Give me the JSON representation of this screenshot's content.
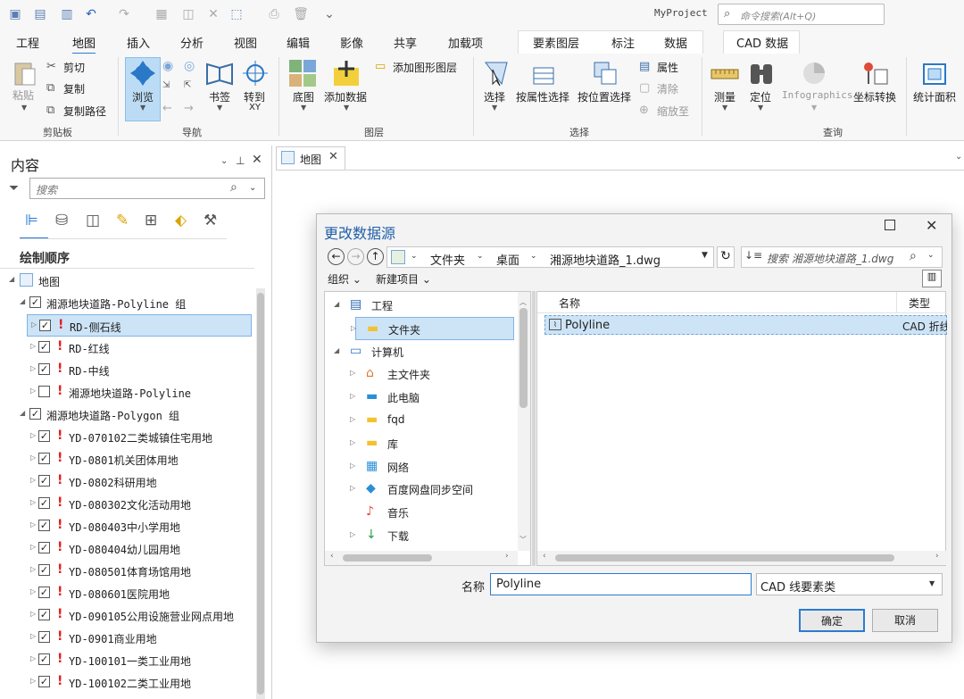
{
  "app": {
    "project_title": "MyProject",
    "command_search_placeholder": "命令搜索(Alt+Q)"
  },
  "ribbon": {
    "tabs": [
      "工程",
      "地图",
      "插入",
      "分析",
      "视图",
      "编辑",
      "影像",
      "共享",
      "加载项"
    ],
    "context_tabs": [
      "要素图层",
      "标注",
      "数据"
    ],
    "cad_tab": "CAD 数据",
    "active_tab": "地图",
    "clipboard": {
      "paste": "粘贴",
      "cut": "剪切",
      "copy": "复制",
      "copy_path": "复制路径",
      "label": "剪贴板"
    },
    "navigate": {
      "explore": "浏览",
      "bookmarks": "书签",
      "goto": "转到",
      "goto_sub": "XY",
      "label": "导航"
    },
    "layer": {
      "basemap": "底图",
      "add_data": "添加数据",
      "add_graphics": "添加图形图层",
      "label": "图层"
    },
    "selection": {
      "select": "选择",
      "by_attr": "按属性选择",
      "by_loc": "按位置选择",
      "attributes": "属性",
      "clear": "清除",
      "zoom_to": "缩放至",
      "label": "选择"
    },
    "inquiry": {
      "measure": "测量",
      "locate": "定位",
      "infographics": "Infographics",
      "coord": "坐标转换",
      "stat_area": "统计面积",
      "label": "查询"
    }
  },
  "contents": {
    "title": "内容",
    "search_placeholder": "搜索",
    "draw_order": "绘制顺序",
    "map_name": "地图",
    "groups": [
      {
        "name": "湘源地块道路-Polyline 组",
        "layers": [
          {
            "name": "RD-侧石线",
            "checked": true,
            "warn": true,
            "selected": true
          },
          {
            "name": "RD-红线",
            "checked": true,
            "warn": true,
            "selected": false
          },
          {
            "name": "RD-中线",
            "checked": true,
            "warn": true,
            "selected": false
          },
          {
            "name": "湘源地块道路-Polyline",
            "checked": false,
            "warn": true,
            "selected": false
          }
        ]
      },
      {
        "name": "湘源地块道路-Polygon 组",
        "layers": [
          {
            "name": "YD-070102二类城镇住宅用地",
            "checked": true,
            "warn": true
          },
          {
            "name": "YD-0801机关团体用地",
            "checked": true,
            "warn": true
          },
          {
            "name": "YD-0802科研用地",
            "checked": true,
            "warn": true
          },
          {
            "name": "YD-080302文化活动用地",
            "checked": true,
            "warn": true
          },
          {
            "name": "YD-080403中小学用地",
            "checked": true,
            "warn": true
          },
          {
            "name": "YD-080404幼儿园用地",
            "checked": true,
            "warn": true
          },
          {
            "name": "YD-080501体育场馆用地",
            "checked": true,
            "warn": true
          },
          {
            "name": "YD-080601医院用地",
            "checked": true,
            "warn": true
          },
          {
            "name": "YD-090105公用设施营业网点用地",
            "checked": true,
            "warn": true
          },
          {
            "name": "YD-0901商业用地",
            "checked": true,
            "warn": true
          },
          {
            "name": "YD-100101一类工业用地",
            "checked": true,
            "warn": true
          },
          {
            "name": "YD-100102二类工业用地",
            "checked": true,
            "warn": true
          }
        ]
      }
    ]
  },
  "map_tab": {
    "label": "地图"
  },
  "dialog": {
    "title": "更改数据源",
    "breadcrumb": [
      "文件夹",
      "桌面",
      "湘源地块道路_1.dwg"
    ],
    "search_placeholder": "搜索 湘源地块道路_1.dwg",
    "organize": "组织",
    "new_item": "新建项目",
    "nav_tree": [
      {
        "label": "工程",
        "icon": "project-icon",
        "level": 0,
        "expanded": true
      },
      {
        "label": "文件夹",
        "icon": "folder-icon",
        "level": 1,
        "selected": true
      },
      {
        "label": "计算机",
        "icon": "computer-icon",
        "level": 0,
        "expanded": true
      },
      {
        "label": "主文件夹",
        "icon": "home-icon",
        "level": 1
      },
      {
        "label": "此电脑",
        "icon": "monitor-icon",
        "level": 1
      },
      {
        "label": "fqd",
        "icon": "folder-icon",
        "level": 1
      },
      {
        "label": "库",
        "icon": "library-icon",
        "level": 1
      },
      {
        "label": "网络",
        "icon": "network-icon",
        "level": 1
      },
      {
        "label": "百度网盘同步空间",
        "icon": "baidu-icon",
        "level": 1
      },
      {
        "label": "音乐",
        "icon": "music-icon",
        "level": 1
      },
      {
        "label": "下载",
        "icon": "download-icon",
        "level": 1
      }
    ],
    "columns": {
      "name": "名称",
      "type": "类型"
    },
    "items": [
      {
        "name": "Polyline",
        "type": "CAD 折线"
      }
    ],
    "name_label": "名称",
    "name_value": "Polyline",
    "filter_value": "CAD 线要素类",
    "ok": "确定",
    "cancel": "取消"
  },
  "colors": {
    "accent": "#2b7bd1",
    "selection": "#cde4f7",
    "warning": "#e02020",
    "title_blue": "#1f5fa8"
  }
}
